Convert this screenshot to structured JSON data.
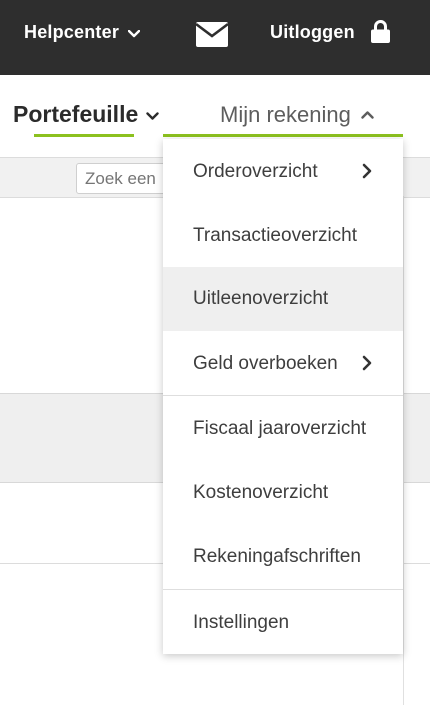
{
  "topbar": {
    "help_label": "Helpcenter",
    "help_icon": "chevron-down-icon",
    "mail_icon": "envelope-icon",
    "logout_label": "Uitloggen",
    "logout_icon": "lock-icon"
  },
  "nav": {
    "portfolio_label": "Portefeuille",
    "account_label": "Mijn rekening",
    "accent_color": "#8cc11f"
  },
  "search": {
    "placeholder": "Zoek een"
  },
  "menu": {
    "items": [
      {
        "label": "Orderoverzicht",
        "has_submenu": true
      },
      {
        "label": "Transactieoverzicht",
        "has_submenu": false
      },
      {
        "label": "Uitleenoverzicht",
        "has_submenu": false,
        "active": true
      },
      {
        "label": "Geld overboeken",
        "has_submenu": true
      },
      {
        "label": "Fiscaal jaaroverzicht",
        "has_submenu": false
      },
      {
        "label": "Kostenoverzicht",
        "has_submenu": false
      },
      {
        "label": "Rekeningafschriften",
        "has_submenu": false
      },
      {
        "label": "Instellingen",
        "has_submenu": false
      }
    ]
  }
}
